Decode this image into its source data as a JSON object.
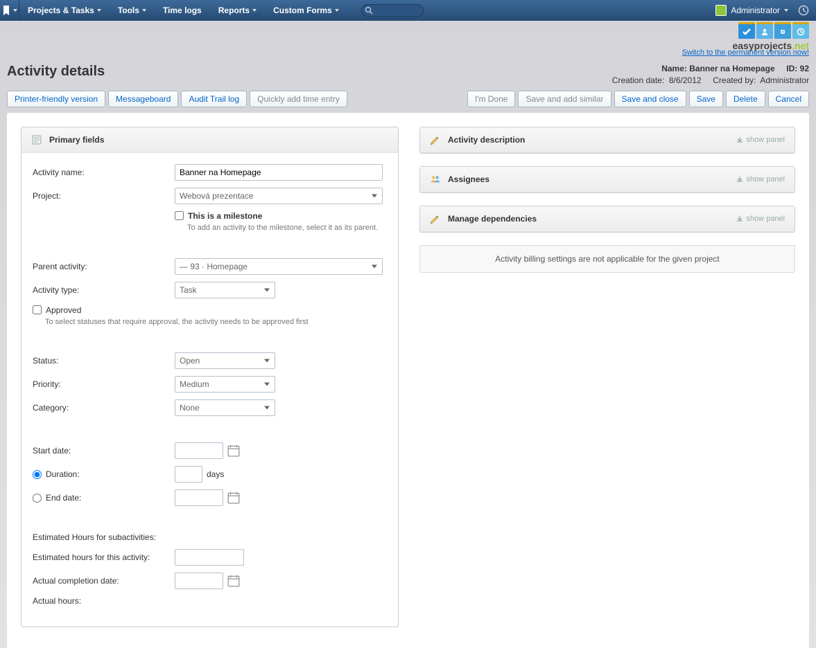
{
  "nav": {
    "projects_tasks": "Projects & Tasks",
    "tools": "Tools",
    "time_logs": "Time logs",
    "reports": "Reports",
    "custom_forms": "Custom Forms",
    "user_name": "Administrator"
  },
  "brand": {
    "name1": "easy",
    "name2": "projects",
    "net": ".net"
  },
  "switch_link": "Switch to the permanent version now!",
  "page_title": "Activity details",
  "meta": {
    "name_label": "Name:",
    "name_value": "Banner na Homepage",
    "id_label": "ID:",
    "id_value": "92",
    "creation_date_label": "Creation date:",
    "creation_date_value": "8/6/2012",
    "created_by_label": "Created by:",
    "created_by_value": "Administrator"
  },
  "toolbar_left": {
    "printer": "Printer-friendly version",
    "messageboard": "Messageboard",
    "audit": "Audit Trail log",
    "quick_add": "Quickly add time entry"
  },
  "toolbar_right": {
    "im_done": "I'm Done",
    "save_add_similar": "Save and add similar",
    "save_close": "Save and close",
    "save": "Save",
    "delete": "Delete",
    "cancel": "Cancel"
  },
  "primary_fields_header": "Primary fields",
  "form": {
    "activity_name_label": "Activity name:",
    "activity_name_value": "Banner na Homepage",
    "project_label": "Project:",
    "project_value": "Webová prezentace",
    "milestone_label": "This is a milestone",
    "milestone_hint": "To add an activity to the milestone, select it as its parent.",
    "parent_activity_label": "Parent activity:",
    "parent_activity_value": "— 93 · Homepage",
    "activity_type_label": "Activity type:",
    "activity_type_value": "Task",
    "approved_label": "Approved",
    "approved_hint": "To select statuses that require approval, the activity needs to be approved first",
    "status_label": "Status:",
    "status_value": "Open",
    "priority_label": "Priority:",
    "priority_value": "Medium",
    "category_label": "Category:",
    "category_value": "None",
    "start_date_label": "Start date:",
    "duration_label": "Duration:",
    "duration_unit": "days",
    "end_date_label": "End date:",
    "est_sub_label": "Estimated Hours for subactivities:",
    "est_this_label": "Estimated hours for this activity:",
    "actual_completion_label": "Actual completion date:",
    "actual_hours_label": "Actual hours:"
  },
  "right_panels": {
    "activity_description": "Activity description",
    "assignees": "Assignees",
    "manage_dependencies": "Manage dependencies",
    "show_panel": "show panel",
    "billing_info": "Activity billing settings are not applicable for the given project"
  }
}
